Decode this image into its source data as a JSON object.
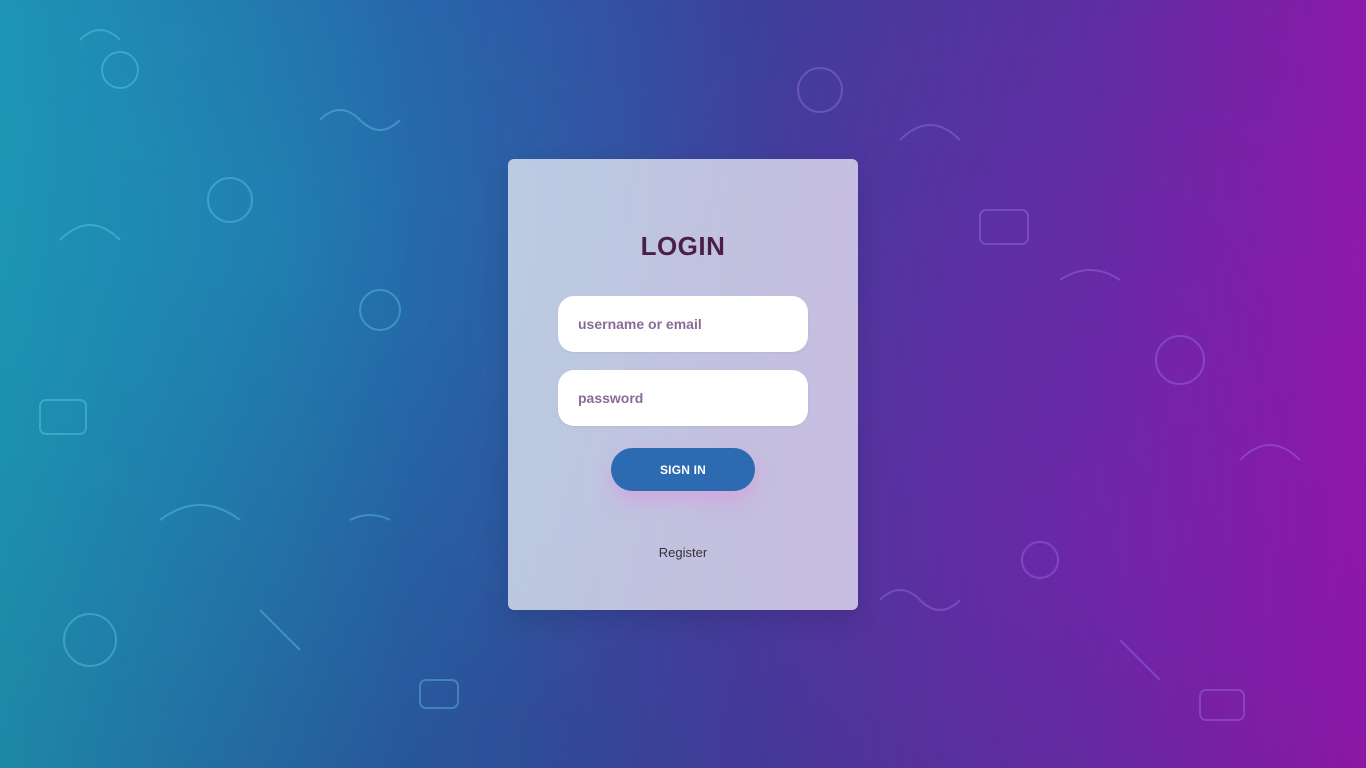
{
  "page": {
    "title": "LOGIN"
  },
  "form": {
    "username_placeholder": "username or email",
    "password_placeholder": "password",
    "signin_label": "SIGN IN",
    "register_label": "Register"
  },
  "colors": {
    "background_start": "#1f8fb0",
    "background_end": "#8a1aa8",
    "title": "#4c1f47",
    "button": "#2c6bb1"
  }
}
